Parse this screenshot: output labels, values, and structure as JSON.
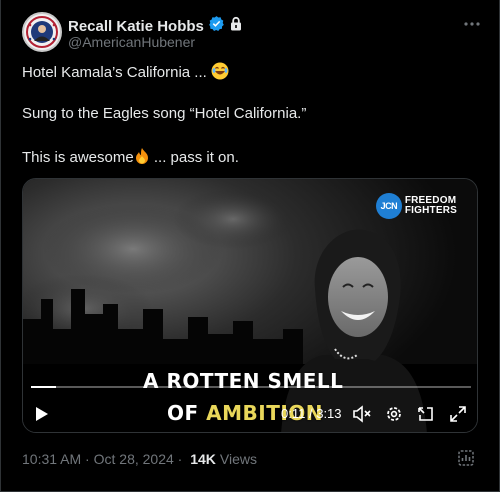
{
  "author": {
    "name": "Recall Katie Hobbs",
    "handle": "@AmericanHubener"
  },
  "post": {
    "line1": "Hotel Kamala’s California ...",
    "line1_emoji": "😂",
    "line2": "Sung to the Eagles song “Hotel California.”",
    "line3_before": "This is awesome",
    "line3_emoji": "🔥",
    "line3_after": " ... pass it on."
  },
  "video": {
    "logo_badge": "JCN",
    "logo_line1": "FREEDOM",
    "logo_line2": "FIGHTERS",
    "caption_line1": "A ROTTEN SMELL",
    "caption_of": "OF",
    "caption_ambition": "AMBITION",
    "current_time": "0:11",
    "separator": "/",
    "duration": "3:13",
    "progress_fraction": 0.057
  },
  "meta": {
    "time": "10:31 AM",
    "dot": " · ",
    "date": "Oct 28, 2024",
    "dot2": " · ",
    "views_count": "14K",
    "views_label": "Views"
  },
  "colors": {
    "background": "#000000",
    "accent": "#1d9bf0",
    "muted": "#71767b",
    "caption_yellow": "#e9d75a"
  },
  "icons": {
    "verified": "verified-badge-icon",
    "protected": "lock-icon",
    "more": "more-dots-icon",
    "play": "play-icon",
    "mute": "speaker-muted-icon",
    "settings": "gear-icon",
    "pip": "picture-in-picture-icon",
    "fullscreen": "expand-icon",
    "analytics": "analytics-icon"
  }
}
